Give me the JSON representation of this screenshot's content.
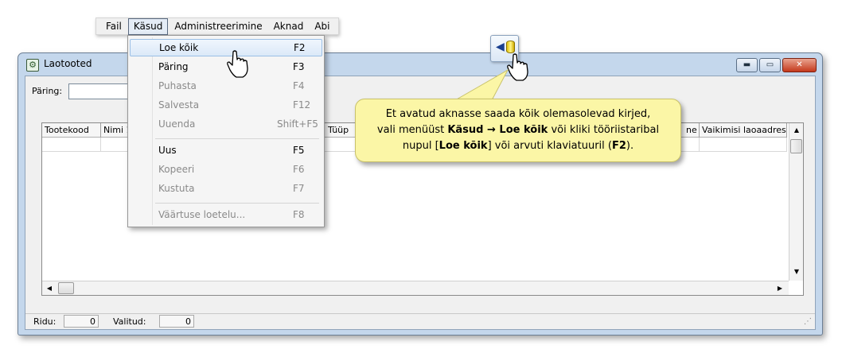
{
  "menubar": {
    "items": [
      "Fail",
      "Käsud",
      "Administreerimine",
      "Aknad",
      "Abi"
    ]
  },
  "window": {
    "title": "Laotooted",
    "buttons": {
      "minimize": "▬",
      "maximize": "▭",
      "close": "✕"
    }
  },
  "query": {
    "label": "Päring:",
    "value": ""
  },
  "grid": {
    "columns": [
      "Tootekood",
      "Nimi 1",
      "Tüüp",
      "ne",
      "Vaikimisi laoaadress"
    ]
  },
  "status": {
    "rows_label": "Ridu:",
    "rows_value": "0",
    "selected_label": "Valitud:",
    "selected_value": "0"
  },
  "dropdown": {
    "items": [
      {
        "label": "Loe kõik",
        "shortcut": "F2",
        "state": "highlighted"
      },
      {
        "label": "Päring",
        "shortcut": "F3",
        "state": "enabled"
      },
      {
        "label": "Puhasta",
        "shortcut": "F4",
        "state": "disabled"
      },
      {
        "label": "Salvesta",
        "shortcut": "F12",
        "state": "disabled"
      },
      {
        "label": "Uuenda",
        "shortcut": "Shift+F5",
        "state": "disabled"
      },
      {
        "label": "Uus",
        "shortcut": "F5",
        "state": "enabled"
      },
      {
        "label": "Kopeeri",
        "shortcut": "F6",
        "state": "disabled"
      },
      {
        "label": "Kustuta",
        "shortcut": "F7",
        "state": "disabled"
      },
      {
        "label": "Väärtuse loetelu...",
        "shortcut": "F8",
        "state": "disabled"
      }
    ]
  },
  "callout": {
    "line1": "Et avatud aknasse saada kõik olemasolevad kirjed,",
    "line2_a": "vali menüüst ",
    "line2_b": "Käsud → Loe kõik",
    "line2_c": " või kliki tööriistaribal",
    "line3_a": "nupul [",
    "line3_b": "Loe kõik",
    "line3_c": "] või arvuti klaviatuuril (",
    "line3_d": "F2",
    "line3_e": ")."
  },
  "colors": {
    "window_frame": "#c4d7ec",
    "callout_bg": "#fbf6a6",
    "menu_highlight": "#dbe9f8",
    "close_button": "#c4391c"
  },
  "icons": [
    "app-icon",
    "load-all-icon",
    "hand-cursor-icon"
  ]
}
